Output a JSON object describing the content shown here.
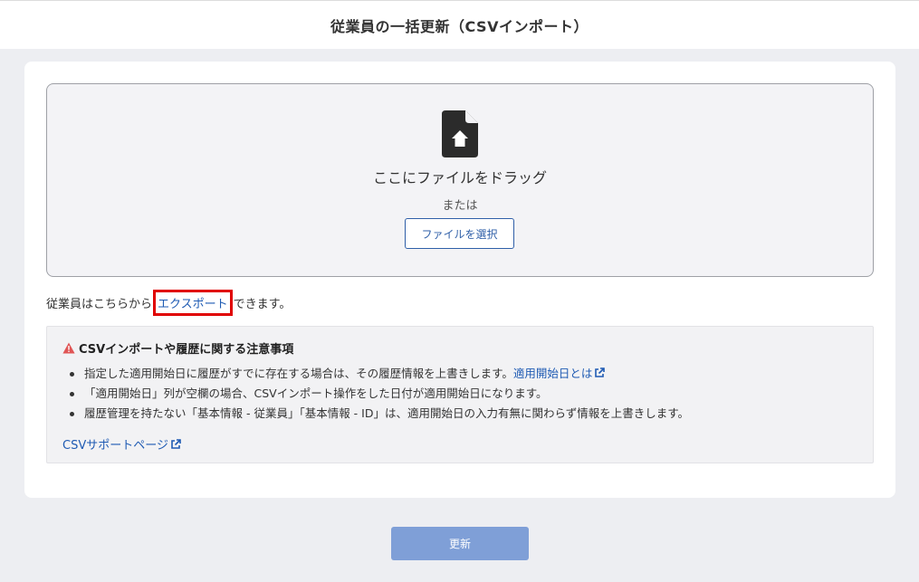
{
  "header": {
    "title": "従業員の一括更新（CSVインポート）"
  },
  "dropzone": {
    "drop_text": "ここにファイルをドラッグ",
    "or_text": "または",
    "select_button": "ファイルを選択"
  },
  "export": {
    "prefix": "従業員はこちらから",
    "link": "エクスポート",
    "suffix": "できます。"
  },
  "notice": {
    "title": "CSVインポートや履歴に関する注意事項",
    "items": [
      {
        "text": "指定した適用開始日に履歴がすでに存在する場合は、その履歴情報を上書きします。",
        "link": "適用開始日とは"
      },
      {
        "text": "「適用開始日」列が空欄の場合、CSVインポート操作をした日付が適用開始日になります。"
      },
      {
        "text": "履歴管理を持たない「基本情報 - 従業員」「基本情報 - ID」は、適用開始日の入力有無に関わらず情報を上書きします。"
      }
    ],
    "support_link": "CSVサポートページ"
  },
  "footer": {
    "update_button": "更新"
  },
  "colors": {
    "accent": "#2f5fa8",
    "link": "#1f5bb3",
    "warning": "#e05555",
    "update_button": "#7f9fd7",
    "highlight": "#e00000"
  },
  "icons": [
    "file-upload-icon",
    "warning-icon",
    "external-link-icon"
  ]
}
